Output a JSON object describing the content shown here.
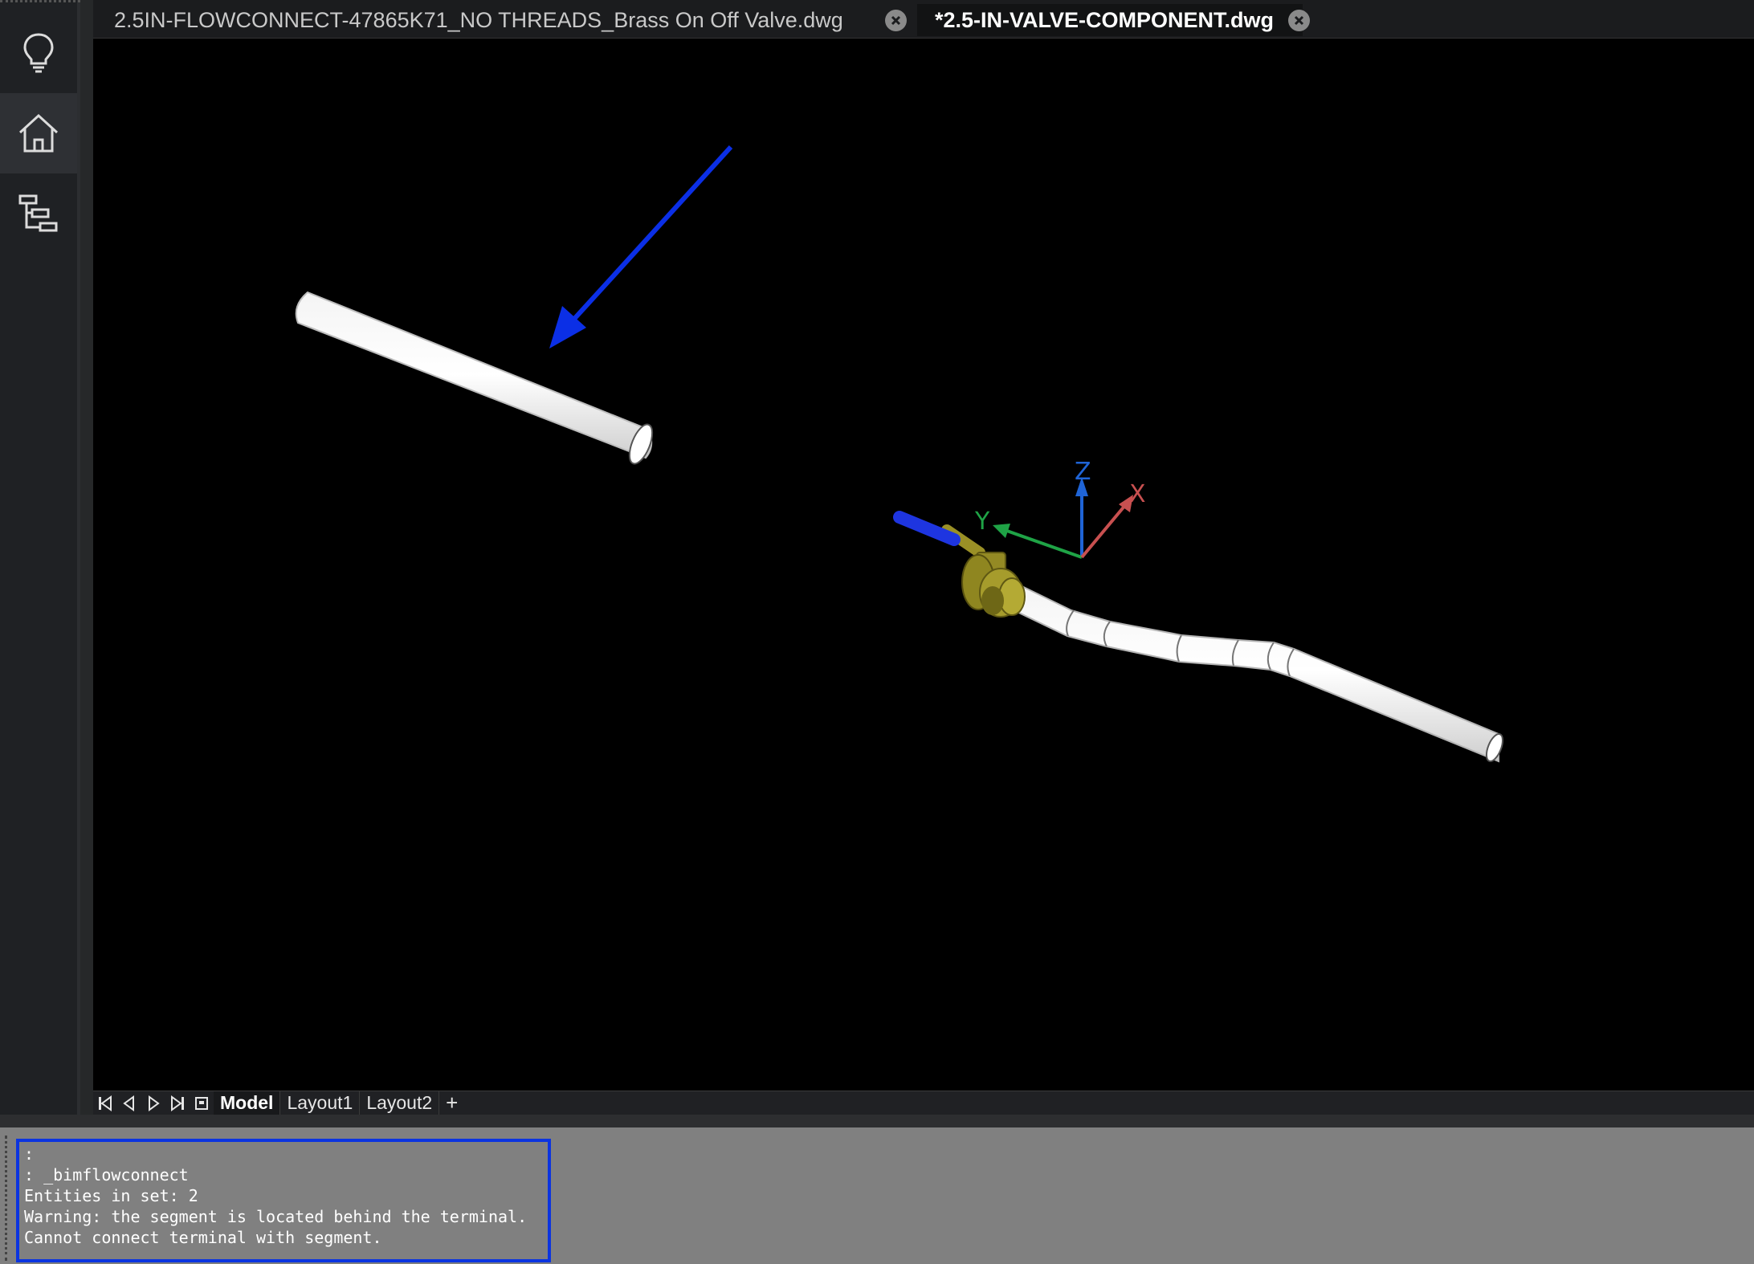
{
  "tabs": [
    {
      "label": "2.5IN-FLOWCONNECT-47865K71_NO THREADS_Brass On Off Valve.dwg",
      "active": false,
      "close_icon": "close-circle-icon"
    },
    {
      "label": "*2.5-IN-VALVE-COMPONENT.dwg",
      "active": true,
      "close_icon": "close-circle-icon"
    }
  ],
  "dock": {
    "items": [
      {
        "name": "lightbulb-icon",
        "active": false
      },
      {
        "name": "home-icon",
        "active": true
      },
      {
        "name": "structure-tree-icon",
        "active": false
      }
    ]
  },
  "viewport": {
    "ucs": {
      "x_label": "X",
      "y_label": "Y",
      "z_label": "Z",
      "x_color": "#c85050",
      "y_color": "#1fa346",
      "z_color": "#1f64d6"
    },
    "annotation_arrow_color": "#0b2fe6",
    "valve_body_color": "#a09626",
    "valve_handle_color": "#1e35e0"
  },
  "layout_tabs": {
    "nav": [
      "first-icon",
      "prev-icon",
      "next-icon",
      "last-icon",
      "layout-menu-icon"
    ],
    "items": [
      {
        "label": "Model",
        "active": true
      },
      {
        "label": "Layout1",
        "active": false
      },
      {
        "label": "Layout2",
        "active": false
      }
    ],
    "add_label": "+"
  },
  "command_line": {
    "lines": [
      ":",
      ": _bimflowconnect",
      "Entities in set: 2",
      "Warning: the segment is located behind the terminal.",
      "Cannot connect terminal with segment."
    ],
    "highlight_color": "#0b34e0"
  }
}
